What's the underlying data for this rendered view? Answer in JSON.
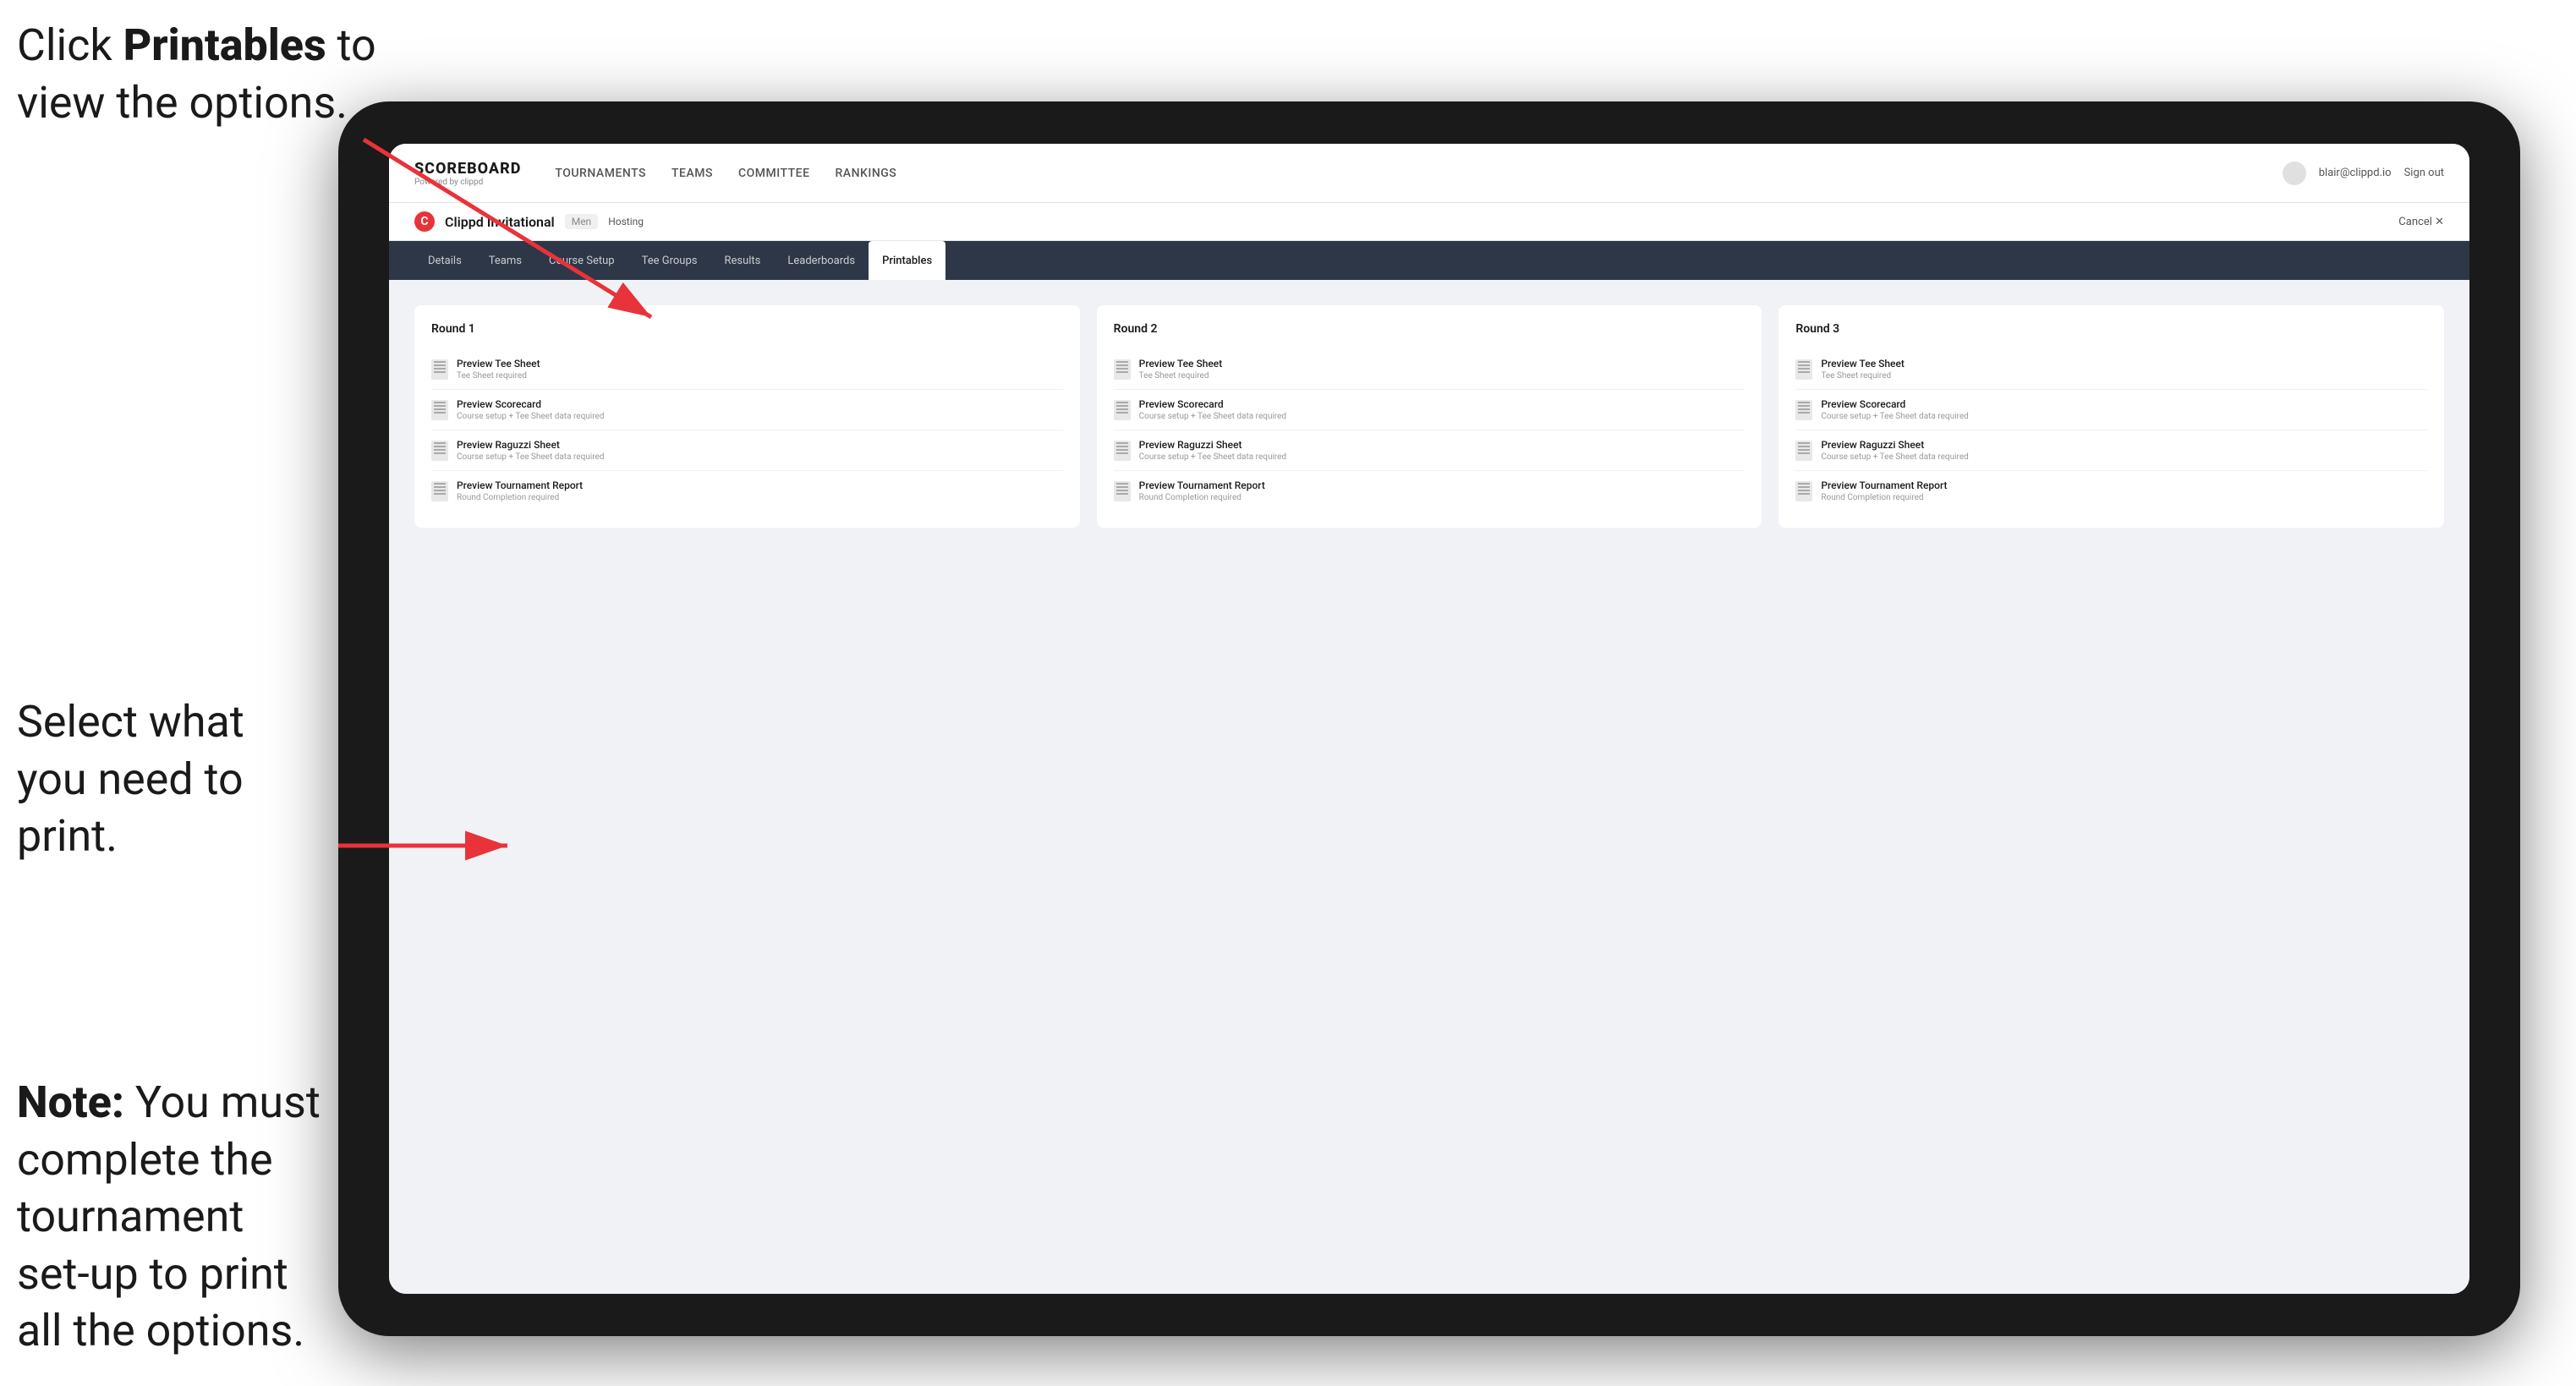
{
  "annotations": {
    "top": {
      "line1": "Click ",
      "bold": "Printables",
      "line1_end": " to",
      "line2": "view the options."
    },
    "middle": {
      "text": "Select what you need to print."
    },
    "bottom": {
      "bold_start": "Note:",
      "text": " You must complete the tournament set-up to print all the options."
    }
  },
  "nav": {
    "logo_title": "SCOREBOARD",
    "logo_subtitle": "Powered by clippd",
    "items": [
      "TOURNAMENTS",
      "TEAMS",
      "COMMITTEE",
      "RANKINGS"
    ],
    "user_email": "blair@clippd.io",
    "sign_out": "Sign out"
  },
  "tournament": {
    "name": "Clippd Invitational",
    "badge": "Men",
    "status": "Hosting",
    "cancel": "Cancel ✕"
  },
  "tabs": [
    {
      "label": "Details",
      "active": false
    },
    {
      "label": "Teams",
      "active": false
    },
    {
      "label": "Course Setup",
      "active": false
    },
    {
      "label": "Tee Groups",
      "active": false
    },
    {
      "label": "Results",
      "active": false
    },
    {
      "label": "Leaderboards",
      "active": false
    },
    {
      "label": "Printables",
      "active": true
    }
  ],
  "rounds": [
    {
      "title": "Round 1",
      "options": [
        {
          "label": "Preview Tee Sheet",
          "sublabel": "Tee Sheet required"
        },
        {
          "label": "Preview Scorecard",
          "sublabel": "Course setup + Tee Sheet data required"
        },
        {
          "label": "Preview Raguzzi Sheet",
          "sublabel": "Course setup + Tee Sheet data required"
        },
        {
          "label": "Preview Tournament Report",
          "sublabel": "Round Completion required"
        }
      ]
    },
    {
      "title": "Round 2",
      "options": [
        {
          "label": "Preview Tee Sheet",
          "sublabel": "Tee Sheet required"
        },
        {
          "label": "Preview Scorecard",
          "sublabel": "Course setup + Tee Sheet data required"
        },
        {
          "label": "Preview Raguzzi Sheet",
          "sublabel": "Course setup + Tee Sheet data required"
        },
        {
          "label": "Preview Tournament Report",
          "sublabel": "Round Completion required"
        }
      ]
    },
    {
      "title": "Round 3",
      "options": [
        {
          "label": "Preview Tee Sheet",
          "sublabel": "Tee Sheet required"
        },
        {
          "label": "Preview Scorecard",
          "sublabel": "Course setup + Tee Sheet data required"
        },
        {
          "label": "Preview Raguzzi Sheet",
          "sublabel": "Course setup + Tee Sheet data required"
        },
        {
          "label": "Preview Tournament Report",
          "sublabel": "Round Completion required"
        }
      ]
    }
  ]
}
